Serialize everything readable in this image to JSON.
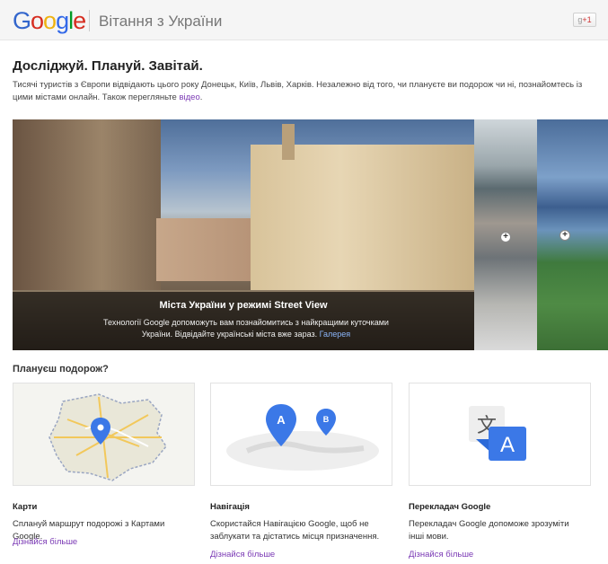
{
  "header": {
    "logo": {
      "l1": "G",
      "l2": "o",
      "l3": "o",
      "l4": "g",
      "l5": "l",
      "l6": "e"
    },
    "title": "Вітання з України",
    "plus_label": "+1"
  },
  "intro": {
    "headline": "Досліджуй. Плануй. Завітай.",
    "text": "Тисячі туристів з Європи відвідають цього року Донецьк, Київ, Львів, Харків. Незалежно від того, чи плануєте ви подорож чи ні, познайомтесь із цими містами онлайн. Також перегляньте ",
    "video_link": "відео",
    "period": "."
  },
  "streetview": {
    "title": "Міста України у режимі Street View",
    "text": "Технології Google допоможуть вам познайомитись з найкращими куточками України. Відвідайте українські міста вже зараз.",
    "gallery_link": "Галерея",
    "thumb_plus": "+"
  },
  "plan": {
    "heading": "Плануєш подорож?",
    "cards": [
      {
        "title": "Карти",
        "desc": "Сплануй маршрут подорожі з Картами Google.",
        "link": "Дізнайся більше"
      },
      {
        "title": "Навігація",
        "desc": "Скористайся Навігацією Google, щоб не заблукати та дістатись місця призначення.",
        "link": "Дізнайся більше"
      },
      {
        "title": "Перекладач Google",
        "desc": "Перекладач Google допоможе зрозуміти інші мови.",
        "link": "Дізнайся більше"
      }
    ],
    "nav_pins": {
      "a": "A",
      "b": "B"
    },
    "translate_icon": {
      "glyph": "文",
      "letter": "A"
    }
  },
  "colors": {
    "link": "#3366cc",
    "visited": "#7b3ab5",
    "pin": "#3b78e7"
  }
}
